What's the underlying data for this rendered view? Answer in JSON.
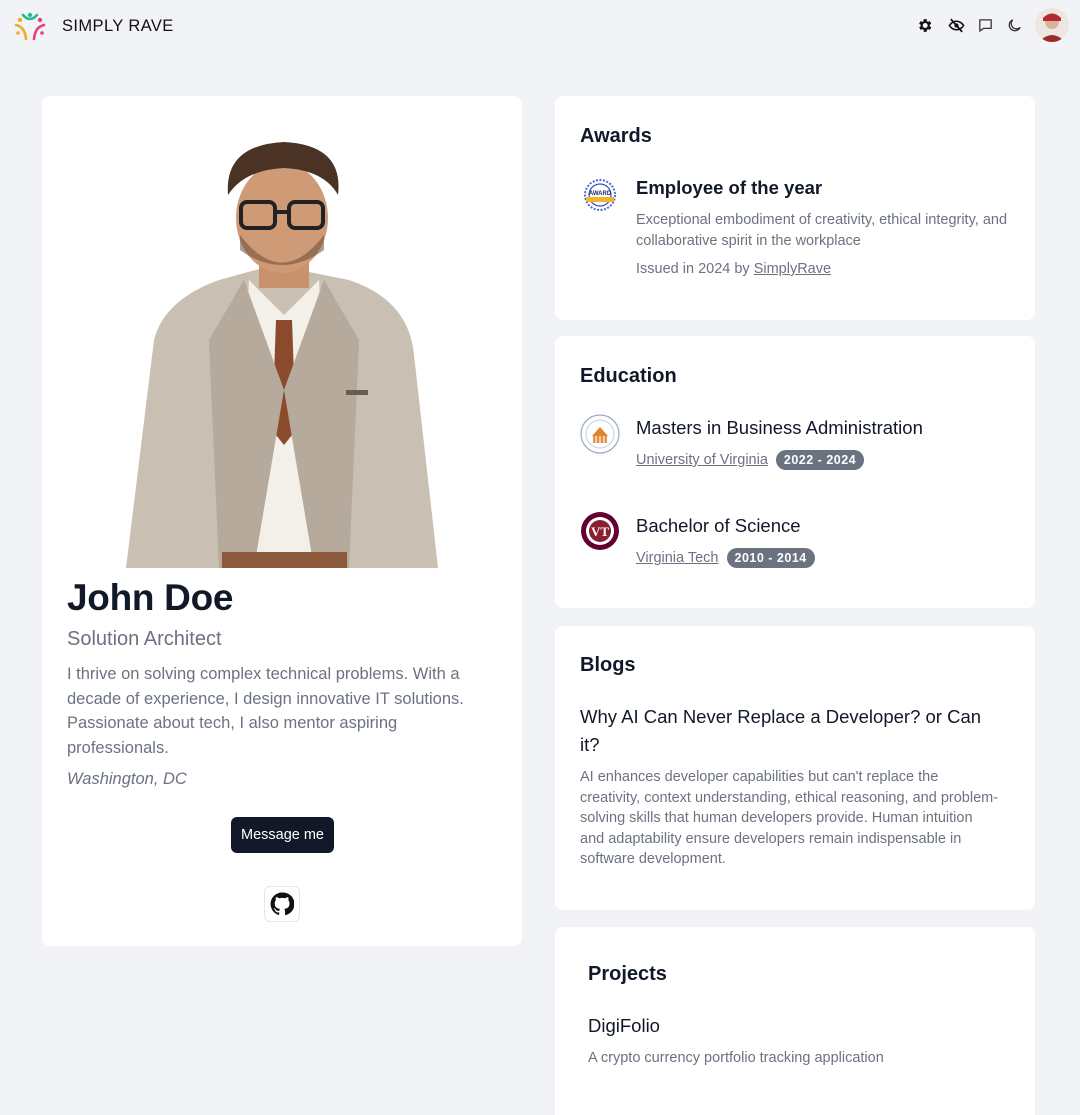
{
  "header": {
    "brand": "SIMPLY RAVE",
    "icons": [
      "settings-icon",
      "eye-off-icon",
      "chat-icon",
      "moon-icon"
    ]
  },
  "profile": {
    "name": "John Doe",
    "role": "Solution Architect",
    "bio": "I thrive on solving complex technical problems. With a decade of experience, I design innovative IT solutions. Passionate about tech, I also mentor aspiring professionals.",
    "location": "Washington, DC",
    "message_button": "Message me",
    "social_icon": "github-icon"
  },
  "awards": {
    "title": "Awards",
    "items": [
      {
        "badge_text": "AWARD",
        "title": "Employee of the year",
        "description": "Exceptional embodiment of creativity, ethical integrity, and collaborative spirit in the workplace",
        "issued_prefix": "Issued in 2024 by",
        "issuer": "SimplyRave"
      }
    ]
  },
  "education": {
    "title": "Education",
    "items": [
      {
        "degree": "Masters in Business Administration",
        "school": "University of Virginia",
        "years": "2022 - 2024"
      },
      {
        "degree": "Bachelor of Science",
        "school": "Virginia Tech",
        "years": "2010 - 2014"
      }
    ]
  },
  "blogs": {
    "title": "Blogs",
    "items": [
      {
        "title": "Why AI Can Never Replace a Developer? or Can it?",
        "body": "AI enhances developer capabilities but can't replace the creativity, context understanding, ethical reasoning, and problem-solving skills that human developers provide. Human intuition and adaptability ensure developers remain indispensable in software development."
      }
    ]
  },
  "projects": {
    "title": "Projects",
    "items": [
      {
        "name": "DigiFolio",
        "description": "A crypto currency portfolio tracking application"
      }
    ]
  },
  "colors": {
    "background": "#f1f3f7",
    "card": "#ffffff",
    "primary_button": "#111827",
    "muted_text": "#6b7280",
    "pill": "#6b7280"
  }
}
